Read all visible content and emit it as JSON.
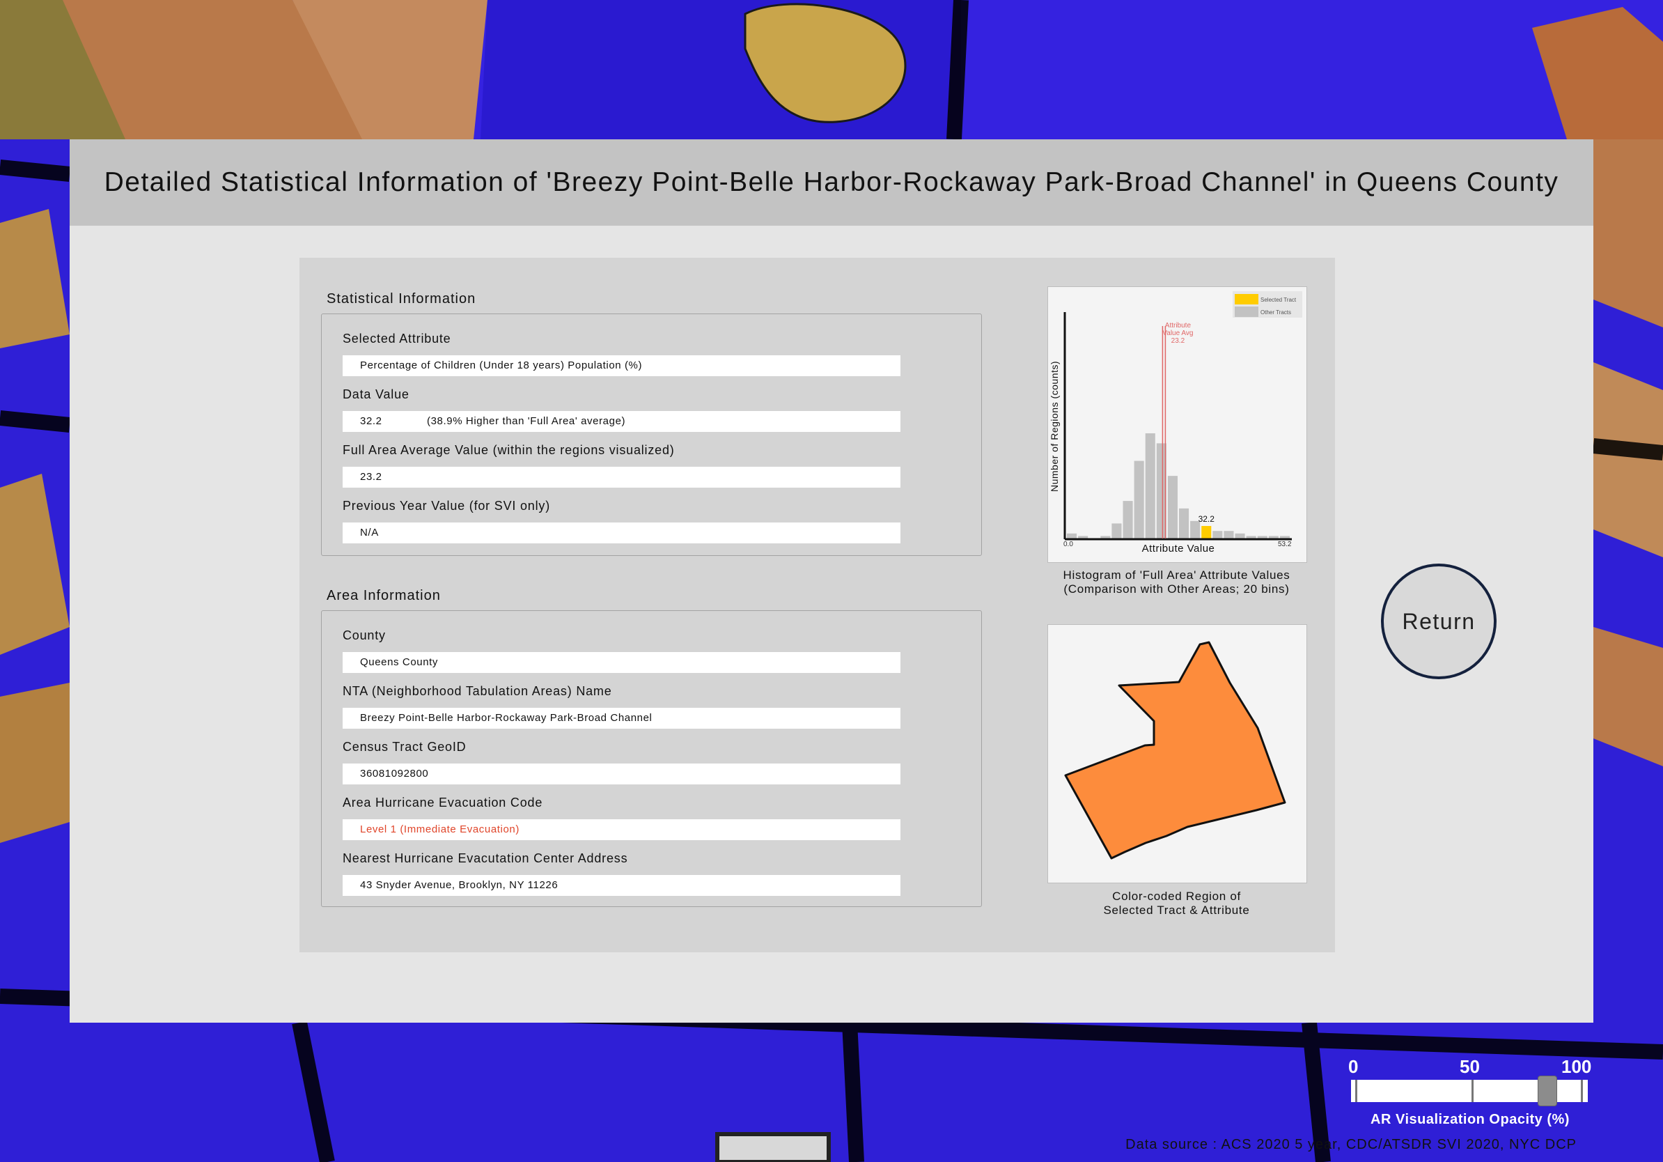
{
  "title": "Detailed Statistical Information of 'Breezy Point-Belle Harbor-Rockaway Park-Broad Channel' in Queens County",
  "statistical_information": {
    "section_label": "Statistical Information",
    "fields": [
      {
        "label": "Selected Attribute",
        "value": "Percentage of Children (Under 18 years) Population (%)"
      },
      {
        "label": "Data Value",
        "value": "32.2",
        "note": "(38.9% Higher than 'Full Area' average)"
      },
      {
        "label": "Full Area Average Value (within the regions visualized)",
        "value": "23.2"
      },
      {
        "label": "Previous Year Value (for SVI only)",
        "value": "N/A"
      }
    ]
  },
  "area_information": {
    "section_label": "Area Information",
    "fields": [
      {
        "label": "County",
        "value": "Queens County"
      },
      {
        "label": "NTA (Neighborhood Tabulation Areas) Name",
        "value": "Breezy Point-Belle Harbor-Rockaway Park-Broad Channel"
      },
      {
        "label": "Census Tract GeoID",
        "value": "36081092800"
      },
      {
        "label": "Area Hurricane Evacuation Code",
        "value": "Level 1 (Immediate Evacuation)"
      },
      {
        "label": "Nearest Hurricane Evacutation Center Address",
        "value": "43 Snyder Avenue, Brooklyn, NY 11226"
      }
    ]
  },
  "chart_data": {
    "type": "bar",
    "xlabel": "Attribute Value",
    "ylabel": "Number of Regions (counts)",
    "x_min_label": "0.0",
    "x_max_label": "53.2",
    "xlim": [
      0.0,
      53.2
    ],
    "bins": 20,
    "counts": [
      2,
      1,
      0,
      1,
      6,
      15,
      31,
      42,
      38,
      25,
      12,
      7,
      5,
      3,
      3,
      2,
      1,
      1,
      1,
      1
    ],
    "selected_bin": 12,
    "selected_value_label": "32.2",
    "average_value": 23.2,
    "average_label": [
      "Attribute",
      "Value Avg",
      "23.2"
    ],
    "legend": [
      "Selected Tract",
      "Other Tracts"
    ],
    "legend_position": "top-right",
    "colors": {
      "selected": "#ffcc00",
      "other": "#c2c2c2",
      "average_line": "#e06666"
    }
  },
  "histogram_caption": [
    "Histogram of 'Full Area' Attribute Values",
    "(Comparison with Other Areas; 20 bins)"
  ],
  "region_caption": [
    "Color-coded Region of",
    "Selected Tract & Attribute"
  ],
  "region_color": "#fd8c3c",
  "return_label": "Return",
  "data_source": "Data source : ACS 2020 5 year, CDC/ATSDR SVI 2020, NYC DCP",
  "opacity_slider": {
    "ticks": [
      "0",
      "50",
      "100"
    ],
    "label": "AR Visualization Opacity (%)",
    "value": 85
  }
}
